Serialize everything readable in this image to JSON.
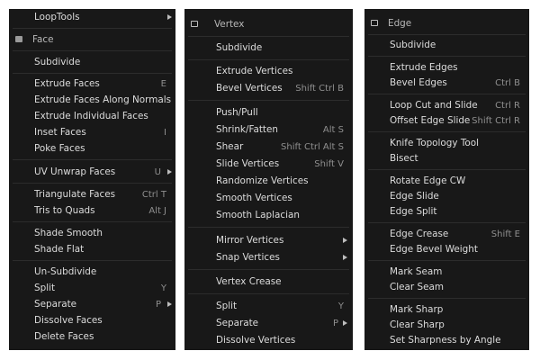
{
  "face_menu": {
    "top_item": "LoopTools",
    "header": "Face",
    "items": {
      "subdivide": "Subdivide",
      "extrude_faces": "Extrude Faces",
      "extrude_faces_shortcut": "E",
      "extrude_faces_along_normals": "Extrude Faces Along Normals",
      "extrude_individual_faces": "Extrude Individual Faces",
      "inset_faces": "Inset Faces",
      "inset_faces_shortcut": "I",
      "poke_faces": "Poke Faces",
      "uv_unwrap_faces": "UV Unwrap Faces",
      "uv_unwrap_faces_shortcut": "U",
      "triangulate_faces": "Triangulate Faces",
      "triangulate_faces_shortcut": "Ctrl T",
      "tris_to_quads": "Tris to Quads",
      "tris_to_quads_shortcut": "Alt J",
      "shade_smooth": "Shade Smooth",
      "shade_flat": "Shade Flat",
      "un_subdivide": "Un-Subdivide",
      "split": "Split",
      "split_shortcut": "Y",
      "separate": "Separate",
      "separate_shortcut": "P",
      "dissolve_faces": "Dissolve Faces",
      "delete_faces": "Delete Faces"
    }
  },
  "vertex_menu": {
    "header": "Vertex",
    "items": {
      "subdivide": "Subdivide",
      "extrude_vertices": "Extrude Vertices",
      "bevel_vertices": "Bevel Vertices",
      "bevel_vertices_shortcut": "Shift Ctrl B",
      "push_pull": "Push/Pull",
      "shrink_fatten": "Shrink/Fatten",
      "shrink_fatten_shortcut": "Alt S",
      "shear": "Shear",
      "shear_shortcut": "Shift Ctrl Alt S",
      "slide_vertices": "Slide Vertices",
      "slide_vertices_shortcut": "Shift V",
      "randomize_vertices": "Randomize Vertices",
      "smooth_vertices": "Smooth Vertices",
      "smooth_laplacian": "Smooth Laplacian",
      "mirror_vertices": "Mirror Vertices",
      "snap_vertices": "Snap Vertices",
      "vertex_crease": "Vertex Crease",
      "split": "Split",
      "split_shortcut": "Y",
      "separate": "Separate",
      "separate_shortcut": "P",
      "dissolve_vertices": "Dissolve Vertices"
    }
  },
  "edge_menu": {
    "header": "Edge",
    "items": {
      "subdivide": "Subdivide",
      "extrude_edges": "Extrude Edges",
      "bevel_edges": "Bevel Edges",
      "bevel_edges_shortcut": "Ctrl B",
      "loop_cut_and_slide": "Loop Cut and Slide",
      "loop_cut_and_slide_shortcut": "Ctrl R",
      "offset_edge_slide": "Offset Edge Slide",
      "offset_edge_slide_shortcut": "Shift Ctrl R",
      "knife_topology_tool": "Knife Topology Tool",
      "bisect": "Bisect",
      "rotate_edge_cw": "Rotate Edge CW",
      "edge_slide": "Edge Slide",
      "edge_split": "Edge Split",
      "edge_crease": "Edge Crease",
      "edge_crease_shortcut": "Shift E",
      "edge_bevel_weight": "Edge Bevel Weight",
      "mark_seam": "Mark Seam",
      "clear_seam": "Clear Seam",
      "mark_sharp": "Mark Sharp",
      "clear_sharp": "Clear Sharp",
      "set_sharpness_by_angle": "Set Sharpness by Angle"
    }
  }
}
